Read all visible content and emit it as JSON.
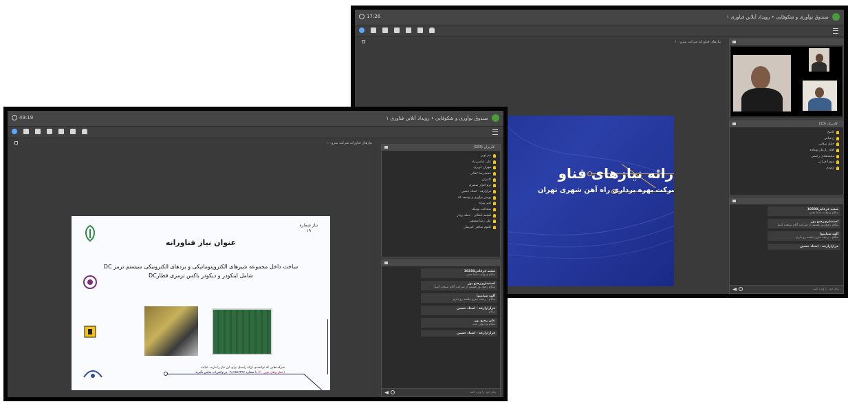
{
  "back_window": {
    "timer": "17:26",
    "room_title": "صندوق نوآوری و شکوفایی • رویداد آنلاین فناوری ۱",
    "slide_pane_title": "نیازهای فناورانه شرکت مترو۱۰۰",
    "slide": {
      "title": "ارائه نیازهای فناو",
      "subtitle": "شرکت بهره برداری راه آهن شهری تهران"
    },
    "users_count": "کاربران (10)",
    "users": [
      "کامبخ",
      "ح.فیاض",
      "جلیل صفایی",
      "آقای زارعان ونداده",
      "محمدهادی رحیمی",
      "مهسا قربانی",
      "ارم‌دی"
    ],
    "chat": [
      {
        "who": "سعید فرقانی10330",
        "text": "سلام و وقت شما بخیر"
      },
      {
        "who": "استشاری‌رفیع پور",
        "text": "سلام رفیع پور هستم از شرکت آکام صنعت آسیا"
      },
      {
        "who": "آلوه سیاه‌پوا",
        "text": "سلام - ردیف مترو جلسه رو دارم"
      },
      {
        "who": "فرازا‌زارقه - استاد حسین",
        "text": ""
      }
    ],
    "chat_placeholder": "پیام خود را وارد کنید"
  },
  "front_window": {
    "timer": "49:19",
    "room_title": "صندوق نوآوری و شکوفایی • رویداد آنلاین فناوری ۱",
    "slide_pane_title": "نیازهای فناورانه شرکت مترو۱۰۰",
    "slide": {
      "need_label": "نیاز شماره",
      "need_number": "۱۹",
      "title": "عنوان نیاز فناورانه",
      "desc_line1": "ساخت داخل مجموعه شیرهای الکتروپنوماتیکی و بردهای الکترونیکی سیستم ترمز DC",
      "desc_line2": "شامل اینکودر و دیکودر باکس ترمزی قطارDC",
      "footer_line1": "شرکت‌هایی که توانمندی ارائه راه‌حل برای این نیاز را دارند، عنایت",
      "footer_red": "(حمل ونقل نوین ۲۰)",
      "footer_line2": "با شماره ۰۹۱۲۵۷۲۴۴۷ در واتس‌اپ تماس بگیرند."
    },
    "users_count": "کاربران (103)",
    "users": [
      "تیم اوبی",
      "علی عباسی‌راد",
      "مهران حریری",
      "محمدرضا کمالی",
      "کامران",
      "نرم افزار سفیری",
      "فرازارقه - استاد حسین",
      "پویش نوآوری و توسعه ۵۶",
      "امیر ویژه",
      "شجاعت بومیک",
      "لطیفه ابطالی - جمله پرداز",
      "علی رضا شفیقی",
      "کلثوم صانعی کبریتیان"
    ],
    "chat": [
      {
        "who": "سعید فرقانی10330",
        "text": "سلام و وقت شما بخیر"
      },
      {
        "who": "استشاری‌رفیع پور",
        "text": "سلام رفیع پور هستم از شرکت آکام صنعت آسیا"
      },
      {
        "who": "آلوه سیاه‌پوا",
        "text": "سلام - ردیف مترو جلسه رو دارم"
      },
      {
        "who": "فرازا‌زارقه - استاد حسین",
        "text": "سلام"
      },
      {
        "who": "علی رفیع پور",
        "text": "سلام و دیوان ثبت"
      },
      {
        "who": "فرازا‌زارقه - استاد حسین",
        "text": ""
      }
    ],
    "chat_placeholder": "پیام خود را وارد کنید"
  },
  "colors": {
    "panel_bg": "#3b3b3b",
    "slide_blue": "#2b3fa8",
    "accent_gold": "#e2b33c",
    "user_icon": "#f0c40e",
    "active_tool": "#5aa9ff"
  },
  "icons": [
    "clock-icon",
    "speaker-icon",
    "mic-off-icon",
    "camera-icon",
    "screen-icon",
    "pen-icon",
    "export-icon",
    "hand-icon",
    "menu-icon",
    "users-icon",
    "chat-icon",
    "send-icon",
    "emoji-icon",
    "logo-icon"
  ]
}
